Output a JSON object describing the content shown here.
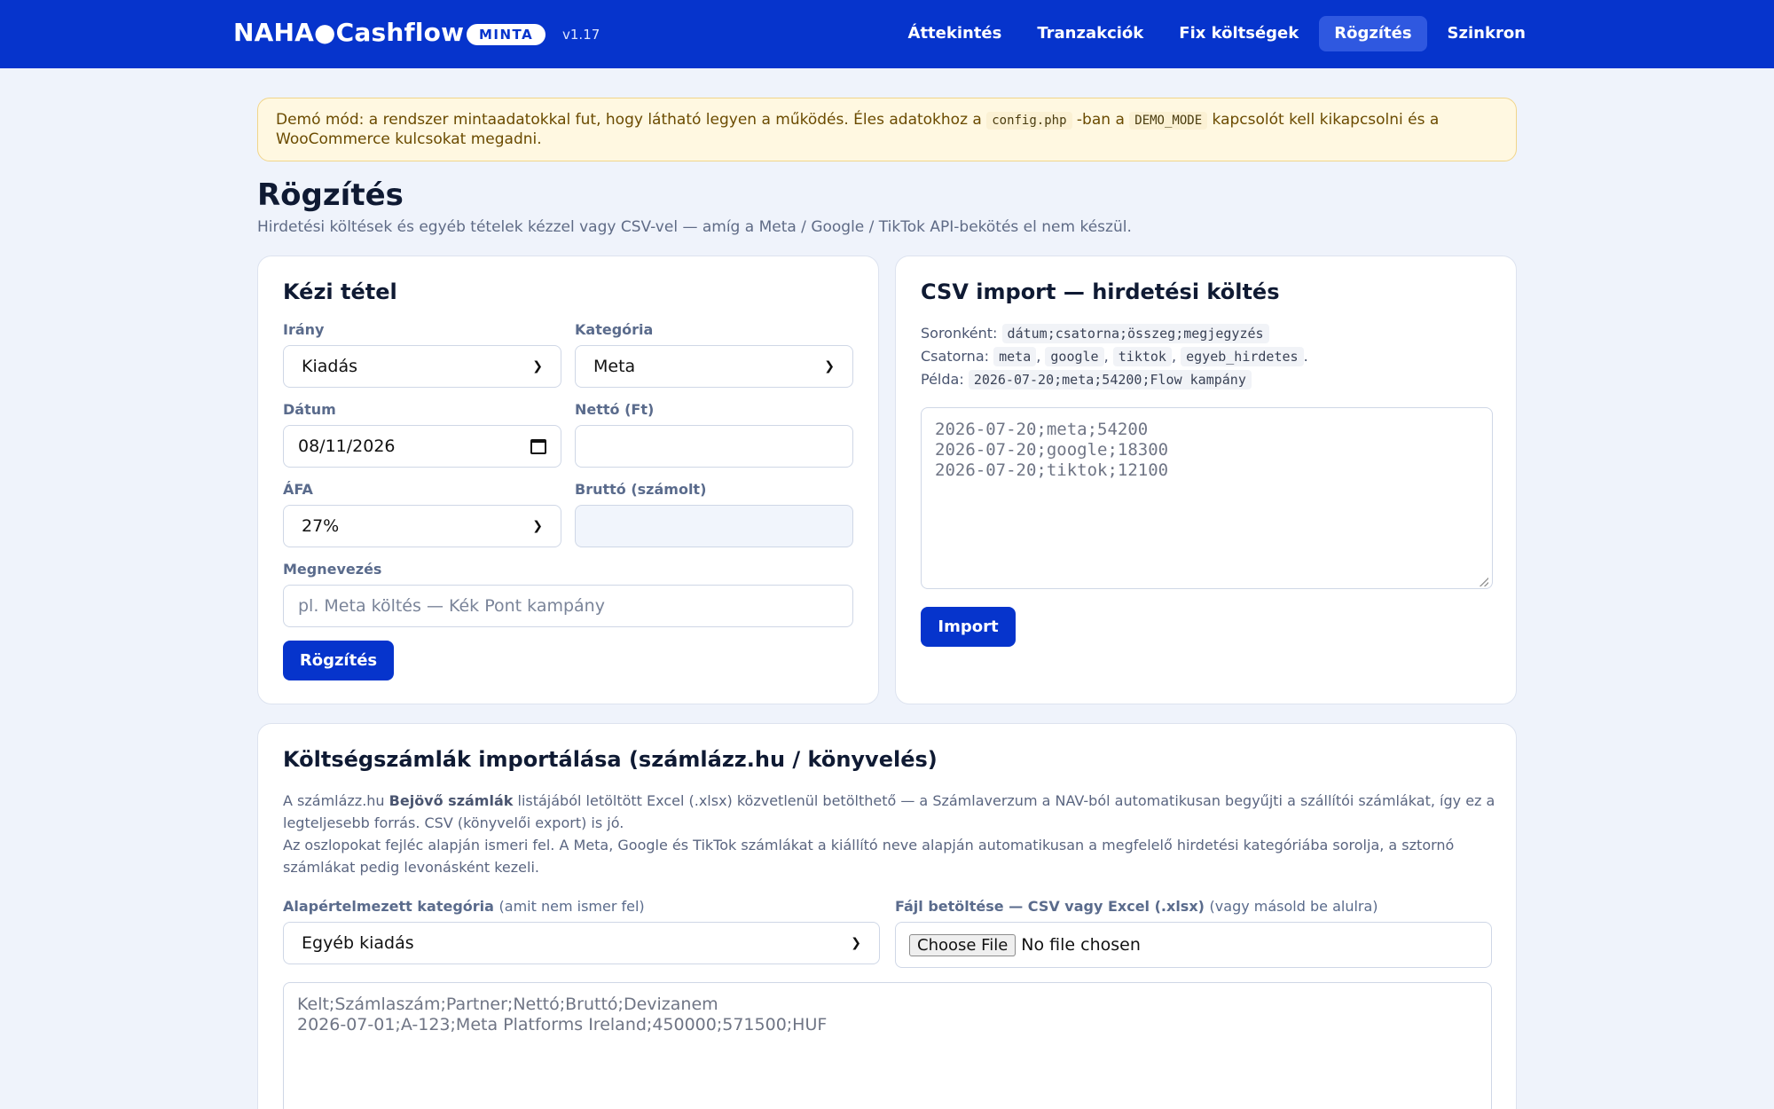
{
  "header": {
    "brand": "NAHA●Cashflow",
    "badge": "MINTA",
    "version": "v1.17",
    "nav": [
      {
        "label": "Áttekintés"
      },
      {
        "label": "Tranzakciók"
      },
      {
        "label": "Fix költségek"
      },
      {
        "label": "Rögzítés"
      },
      {
        "label": "Szinkron"
      }
    ]
  },
  "notice": {
    "text_1": "Demó mód: a rendszer mintaadatokkal fut, hogy látható legyen a működés. Éles adatokhoz a ",
    "code_1": "config.php",
    "text_2": " -ban a ",
    "code_2": "DEMO_MODE",
    "text_3": " kapcsolót kell kikapcsolni és a WooCommerce kulcsokat megadni."
  },
  "page": {
    "title": "Rögzítés",
    "subtitle": "Hirdetési költések és egyéb tételek kézzel vagy CSV-vel — amíg a Meta / Google / TikTok API-bekötés el nem készül."
  },
  "manual": {
    "title": "Kézi tétel",
    "direction_label": "Irány",
    "direction_value": "Kiadás",
    "category_label": "Kategória",
    "category_value": "Meta",
    "date_label": "Dátum",
    "date_value": "08/11/2026",
    "net_label": "Nettó (Ft)",
    "net_value": "",
    "vat_label": "ÁFA",
    "vat_value": "27%",
    "gross_label": "Bruttó (számolt)",
    "gross_value": "",
    "name_label": "Megnevezés",
    "name_placeholder": "pl. Meta költés — Kék Pont kampány",
    "submit_label": "Rögzítés"
  },
  "csv": {
    "title": "CSV import — hirdetési költés",
    "row_label": "Soronként:",
    "row_format": "dátum;csatorna;összeg;megjegyzés",
    "channel_label": "Csatorna:",
    "channels": [
      "meta",
      "google",
      "tiktok",
      "egyeb_hirdetes"
    ],
    "example_label": "Példa:",
    "example": "2026-07-20;meta;54200;Flow kampány",
    "placeholder": "2026-07-20;meta;54200\n2026-07-20;google;18300\n2026-07-20;tiktok;12100",
    "import_label": "Import"
  },
  "invoices": {
    "title": "Költségszámlák importálása (számlázz.hu / könyvelés)",
    "desc_1a": "A számlázz.hu ",
    "desc_1b": "Bejövő számlák",
    "desc_1c": " listájából letöltött Excel (.xlsx) közvetlenül betölthető — a Számlaverzum a NAV-ból automatikusan begyűjti a szállítói számlákat, így ez a legteljesebb forrás. CSV (könyvelői export) is jó.",
    "desc_2": "Az oszlopokat fejléc alapján ismeri fel. A Meta, Google és TikTok számlákat a kiállító neve alapján automatikusan a megfelelő hirdetési kategóriába sorolja, a sztornó számlákat pedig levonásként kezeli.",
    "default_cat_label": "Alapértelmezett kategória",
    "default_cat_hint": "(amit nem ismer fel)",
    "default_cat_value": "Egyéb kiadás",
    "file_label": "Fájl betöltése — CSV vagy Excel (.xlsx)",
    "file_hint": "(vagy másold be alulra)",
    "file_button": "Choose File",
    "file_status": "No file chosen",
    "paste_placeholder": "Kelt;Számlaszám;Partner;Nettó;Bruttó;Devizanem\n2026-07-01;A-123;Meta Platforms Ireland;450000;571500;HUF"
  }
}
